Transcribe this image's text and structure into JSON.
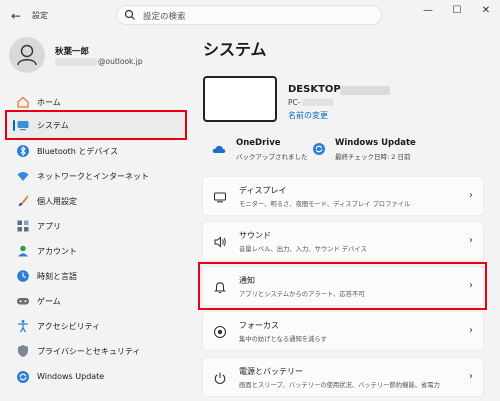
{
  "window": {
    "back_glyph": "←",
    "title": "設定",
    "search_placeholder": "設定の検索",
    "controls": [
      "—",
      "☐",
      "✕"
    ]
  },
  "user": {
    "name": "秋葉一郎",
    "email_suffix": "@outlook.jp"
  },
  "sidebar": {
    "items": [
      {
        "label": "ホーム",
        "icon": "home-icon"
      },
      {
        "label": "システム",
        "icon": "system-icon",
        "active": true
      },
      {
        "label": "Bluetooth とデバイス",
        "icon": "bluetooth-icon"
      },
      {
        "label": "ネットワークとインターネット",
        "icon": "network-icon"
      },
      {
        "label": "個人用設定",
        "icon": "brush-icon"
      },
      {
        "label": "アプリ",
        "icon": "apps-icon"
      },
      {
        "label": "アカウント",
        "icon": "account-icon"
      },
      {
        "label": "時刻と言語",
        "icon": "time-language-icon"
      },
      {
        "label": "ゲーム",
        "icon": "game-icon"
      },
      {
        "label": "アクセシビリティ",
        "icon": "accessibility-icon"
      },
      {
        "label": "プライバシーとセキュリティ",
        "icon": "shield-icon"
      },
      {
        "label": "Windows Update",
        "icon": "windows-update-icon"
      }
    ]
  },
  "main": {
    "title": "システム",
    "device": {
      "name_prefix": "DESKTOP-",
      "model_prefix": "PC-",
      "rename_label": "名前の変更"
    },
    "status": [
      {
        "title": "OneDrive",
        "sub": "バックアップされました",
        "icon": "onedrive-icon"
      },
      {
        "title": "Windows Update",
        "sub": "最終チェック日時: 2 日前",
        "icon": "windows-update-icon"
      }
    ],
    "cards": [
      {
        "title": "ディスプレイ",
        "sub": "モニター、明るさ、夜間モード、ディスプレイ プロファイル",
        "icon": "display-icon",
        "chevron": "›"
      },
      {
        "title": "サウンド",
        "sub": "音量レベル、出力、入力、サウンド デバイス",
        "icon": "sound-icon",
        "chevron": "›"
      },
      {
        "title": "通知",
        "sub": "アプリとシステムからのアラート、応答不可",
        "icon": "bell-icon",
        "chevron": "›"
      },
      {
        "title": "フォーカス",
        "sub": "集中の妨げとなる通知を減らす",
        "icon": "focus-icon",
        "chevron": "›"
      },
      {
        "title": "電源とバッテリー",
        "sub": "画面とスリープ、バッテリーの使用状況、バッテリー節約機能、省電力",
        "icon": "power-icon",
        "chevron": "›"
      }
    ]
  },
  "colors": {
    "accent": "#0067c0",
    "highlight": "#e60012"
  }
}
